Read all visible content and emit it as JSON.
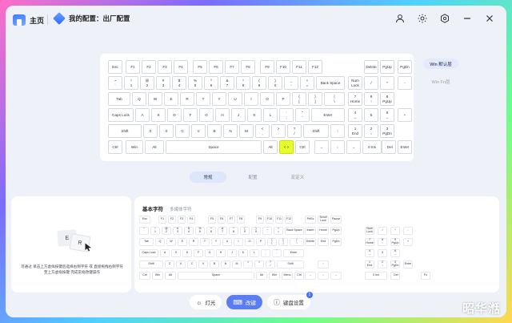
{
  "header": {
    "home_label": "主页",
    "config_label": "我的配置：出厂配置",
    "icons": [
      "user-icon",
      "brightness-icon",
      "settings-icon",
      "minimize-icon",
      "close-icon"
    ]
  },
  "layers": {
    "active": "Win 默认层",
    "inactive": "Win Fn层"
  },
  "keyboard_rows": [
    [
      [
        "Esc",
        0,
        18
      ],
      [
        "F1",
        22,
        18
      ],
      [
        "F2",
        42,
        18
      ],
      [
        "F3",
        62,
        18
      ],
      [
        "F4",
        82,
        18
      ],
      [
        "F5",
        106,
        18
      ],
      [
        "F6",
        126,
        18
      ],
      [
        "F7",
        146,
        18
      ],
      [
        "F8",
        166,
        18
      ],
      [
        "F9",
        190,
        18
      ],
      [
        "F10",
        210,
        18
      ],
      [
        "F11",
        230,
        18
      ],
      [
        "F12",
        250,
        18
      ],
      [
        "Delete",
        320,
        18
      ],
      [
        "PgUp",
        340,
        18
      ],
      [
        "PgDn",
        362,
        18
      ]
    ],
    [
      [
        "~\n`",
        0,
        18
      ],
      [
        "!\n1",
        20,
        18
      ],
      [
        "@\n2",
        40,
        18
      ],
      [
        "#\n3",
        60,
        18
      ],
      [
        "$\n4",
        80,
        18
      ],
      [
        "%\n5",
        100,
        18
      ],
      [
        "^\n6",
        120,
        18
      ],
      [
        "&\n7",
        140,
        18
      ],
      [
        "*\n8",
        160,
        18
      ],
      [
        "(\n9",
        180,
        18
      ],
      [
        ")\n0",
        200,
        18
      ],
      [
        "_\n-",
        220,
        18
      ],
      [
        "+\n=",
        240,
        18
      ],
      [
        "Back Space",
        260,
        36
      ],
      [
        "Num\nLock",
        300,
        18
      ],
      [
        "/",
        320,
        18
      ],
      [
        "*",
        340,
        18
      ],
      [
        "-",
        362,
        18
      ]
    ],
    [
      [
        "Tab",
        0,
        28
      ],
      [
        "Q",
        30,
        18
      ],
      [
        "W",
        50,
        18
      ],
      [
        "E",
        70,
        18
      ],
      [
        "R",
        90,
        18
      ],
      [
        "T",
        110,
        18
      ],
      [
        "Y",
        130,
        18
      ],
      [
        "U",
        150,
        18
      ],
      [
        "I",
        170,
        18
      ],
      [
        "O",
        190,
        18
      ],
      [
        "P",
        210,
        18
      ],
      [
        "{\n[",
        230,
        18
      ],
      [
        "}\n]",
        250,
        18
      ],
      [
        "|\n\\",
        270,
        26
      ],
      [
        "7\nHome",
        300,
        18
      ],
      [
        "8\n↑",
        320,
        18
      ],
      [
        "9\nPgUp",
        340,
        18
      ]
    ],
    [
      [
        "Caps Lock",
        0,
        32
      ],
      [
        "A",
        34,
        18
      ],
      [
        "S",
        54,
        18
      ],
      [
        "D",
        74,
        18
      ],
      [
        "F",
        94,
        18
      ],
      [
        "G",
        114,
        18
      ],
      [
        "H",
        134,
        18
      ],
      [
        "J",
        154,
        18
      ],
      [
        "K",
        174,
        18
      ],
      [
        "L",
        194,
        18
      ],
      [
        ":\n;",
        214,
        18
      ],
      [
        "\"\n'",
        234,
        18
      ],
      [
        "Enter",
        254,
        42
      ],
      [
        "4\n←",
        300,
        18
      ],
      [
        "5",
        320,
        18
      ],
      [
        "6\n→",
        340,
        18
      ],
      [
        "+",
        362,
        18
      ]
    ],
    [
      [
        "Shift",
        0,
        42
      ],
      [
        "Z",
        44,
        18
      ],
      [
        "X",
        64,
        18
      ],
      [
        "C",
        84,
        18
      ],
      [
        "V",
        104,
        18
      ],
      [
        "B",
        124,
        18
      ],
      [
        "N",
        144,
        18
      ],
      [
        "M",
        164,
        18
      ],
      [
        "<\n,",
        184,
        18
      ],
      [
        ">\n.",
        204,
        18
      ],
      [
        "?\n/",
        224,
        18
      ],
      [
        "Shift",
        244,
        32
      ],
      [
        "↑",
        278,
        18
      ],
      [
        "1\nEnd",
        300,
        18
      ],
      [
        "2\n↓",
        320,
        18
      ],
      [
        "3\nPgDn",
        340,
        18
      ]
    ],
    [
      [
        "Ctrl",
        0,
        18
      ],
      [
        "Win",
        22,
        22
      ],
      [
        "Alt",
        46,
        24
      ],
      [
        "Space",
        72,
        120
      ],
      [
        "Alt",
        194,
        18
      ],
      [
        "< >",
        214,
        18,
        "hl"
      ],
      [
        "Ctrl",
        234,
        18
      ],
      [
        "←",
        258,
        18
      ],
      [
        "↓",
        278,
        18
      ],
      [
        "→",
        298,
        18
      ],
      [
        "0 Ins",
        318,
        24
      ],
      [
        ". Del",
        342,
        18
      ],
      [
        "Enter",
        362,
        18
      ]
    ]
  ],
  "tabs": [
    "常规",
    "配置",
    "宏定义"
  ],
  "demo": {
    "key1": "E",
    "key2": "R",
    "text": "可通过 单击上方虚拟按键后选择右侧字符 或 直接拖拽右侧字符至上方虚拟按键 完成常规改键操作"
  },
  "library": {
    "tab_active": "基本字符",
    "tab_inactive": "多媒体字符",
    "rows": [
      [
        [
          "Esc",
          0,
          14
        ],
        [
          "F1",
          24,
          10
        ],
        [
          "F2",
          36,
          10
        ],
        [
          "F3",
          48,
          10
        ],
        [
          "F4",
          60,
          10
        ],
        [
          "F5",
          86,
          10
        ],
        [
          "F6",
          98,
          10
        ],
        [
          "F7",
          110,
          10
        ],
        [
          "F8",
          122,
          10
        ],
        [
          "F9",
          146,
          10
        ],
        [
          "F10",
          158,
          10
        ],
        [
          "F11",
          170,
          10
        ],
        [
          "F12",
          182,
          10
        ],
        [
          "PrtSc",
          207,
          14
        ],
        [
          "Scroll\nLock",
          223,
          14
        ],
        [
          "Pause",
          239,
          14
        ]
      ],
      [
        [
          "~\n`",
          0,
          12
        ],
        [
          "!\n1",
          14,
          12
        ],
        [
          "@\n2",
          28,
          12
        ],
        [
          "#\n3",
          42,
          12
        ],
        [
          "$\n4",
          56,
          12
        ],
        [
          "%\n5",
          70,
          12
        ],
        [
          "^\n6",
          84,
          12
        ],
        [
          "&\n7",
          98,
          12
        ],
        [
          "*\n8",
          112,
          12
        ],
        [
          "(\n9",
          126,
          12
        ],
        [
          ")\n0",
          140,
          12
        ],
        [
          "_\n-",
          154,
          12
        ],
        [
          "+\n=",
          168,
          12
        ],
        [
          "Back Space",
          182,
          24
        ],
        [
          "Insert",
          207,
          14
        ],
        [
          "Home",
          223,
          14
        ],
        [
          "PgUp",
          239,
          14
        ],
        [
          "Num\nLock",
          282,
          12
        ],
        [
          "/",
          298,
          12
        ],
        [
          "*",
          314,
          12
        ],
        [
          "-",
          330,
          12
        ]
      ],
      [
        [
          "Tab",
          0,
          18
        ],
        [
          "Q",
          20,
          12
        ],
        [
          "W",
          34,
          12
        ],
        [
          "E",
          48,
          12
        ],
        [
          "R",
          62,
          12
        ],
        [
          "T",
          76,
          12
        ],
        [
          "Y",
          90,
          12
        ],
        [
          "U",
          104,
          12
        ],
        [
          "I",
          118,
          12
        ],
        [
          "O",
          132,
          12
        ],
        [
          "P",
          146,
          12
        ],
        [
          "{\n[",
          160,
          12
        ],
        [
          "}\n]",
          174,
          12
        ],
        [
          "|\n\\",
          188,
          18
        ],
        [
          "Delete",
          207,
          14
        ],
        [
          "End",
          223,
          14
        ],
        [
          "PgDn",
          239,
          14
        ],
        [
          "7\nHome",
          282,
          12
        ],
        [
          "8\n↑",
          298,
          12
        ],
        [
          "9\nPgUp",
          314,
          12
        ],
        [
          "+",
          330,
          12
        ]
      ],
      [
        [
          "Caps Lock",
          0,
          24
        ],
        [
          "A",
          26,
          12
        ],
        [
          "S",
          40,
          12
        ],
        [
          "D",
          54,
          12
        ],
        [
          "F",
          68,
          12
        ],
        [
          "G",
          82,
          12
        ],
        [
          "H",
          96,
          12
        ],
        [
          "J",
          110,
          12
        ],
        [
          "K",
          124,
          12
        ],
        [
          "L",
          138,
          12
        ],
        [
          ":\n;",
          152,
          12
        ],
        [
          "\"\n'",
          166,
          12
        ],
        [
          "Enter",
          180,
          26
        ],
        [
          "4\n←",
          282,
          12
        ],
        [
          "5",
          298,
          12
        ],
        [
          "6\n→",
          314,
          12
        ]
      ],
      [
        [
          "Shift",
          0,
          30
        ],
        [
          "Z",
          32,
          12
        ],
        [
          "X",
          46,
          12
        ],
        [
          "C",
          60,
          12
        ],
        [
          "V",
          74,
          12
        ],
        [
          "B",
          88,
          12
        ],
        [
          "N",
          102,
          12
        ],
        [
          "M",
          116,
          12
        ],
        [
          "<\n,",
          130,
          12
        ],
        [
          ">\n.",
          144,
          12
        ],
        [
          "?\n/",
          158,
          12
        ],
        [
          "Shift",
          172,
          34
        ],
        [
          "↑",
          223,
          14
        ],
        [
          "1\nEnd",
          282,
          12
        ],
        [
          "2\n↓",
          298,
          12
        ],
        [
          "3\nPgDn",
          314,
          12
        ],
        [
          "Enter",
          330,
          12
        ]
      ],
      [
        [
          "Ctrl",
          0,
          14
        ],
        [
          "Win",
          16,
          14
        ],
        [
          "Alt",
          32,
          14
        ],
        [
          "Space",
          48,
          96
        ],
        [
          "Alt",
          146,
          14
        ],
        [
          "Win",
          162,
          14
        ],
        [
          "Menu",
          178,
          14
        ],
        [
          "Ctrl",
          194,
          12
        ],
        [
          "←",
          207,
          14
        ],
        [
          "↓",
          223,
          14
        ],
        [
          "→",
          239,
          14
        ],
        [
          "0 Ins",
          282,
          28
        ],
        [
          ". Del",
          314,
          12
        ],
        [
          "Fn",
          352,
          12
        ]
      ]
    ]
  },
  "bottom_nav": {
    "light": "灯光",
    "keys": "改键",
    "settings": "键盘设置",
    "badge": "1"
  },
  "watermark": "昭华湉"
}
